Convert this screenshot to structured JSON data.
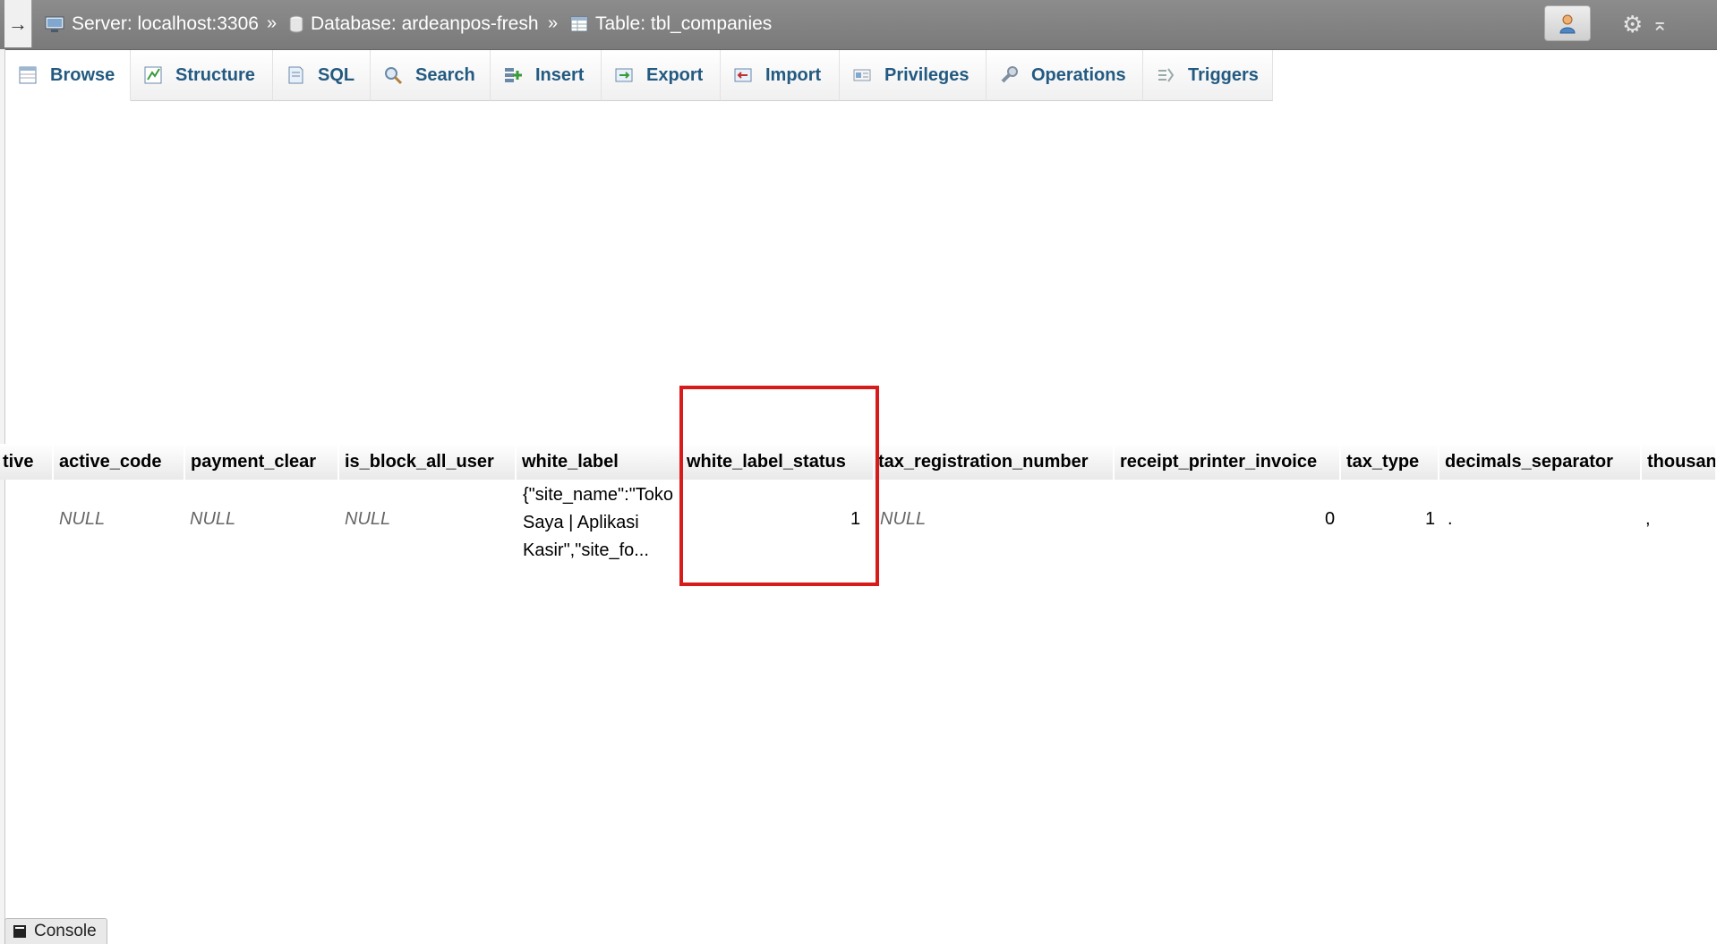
{
  "breadcrumb": {
    "toggle_icon": "→",
    "server": "Server: localhost:3306",
    "database": "Database: ardeanpos-fresh",
    "table": "Table: tbl_companies",
    "separator": "»"
  },
  "tabs": [
    {
      "label": "Browse",
      "icon": "browse-icon"
    },
    {
      "label": "Structure",
      "icon": "structure-icon"
    },
    {
      "label": "SQL",
      "icon": "sql-icon"
    },
    {
      "label": "Search",
      "icon": "search-icon"
    },
    {
      "label": "Insert",
      "icon": "insert-icon"
    },
    {
      "label": "Export",
      "icon": "export-icon"
    },
    {
      "label": "Import",
      "icon": "import-icon"
    },
    {
      "label": "Privileges",
      "icon": "privileges-icon"
    },
    {
      "label": "Operations",
      "icon": "operations-icon"
    },
    {
      "label": "Triggers",
      "icon": "triggers-icon"
    }
  ],
  "table": {
    "columns": [
      "tive",
      "active_code",
      "payment_clear",
      "is_block_all_user",
      "white_label",
      "white_label_status",
      "tax_registration_number",
      "receipt_printer_invoice",
      "tax_type",
      "decimals_separator",
      "thousan"
    ],
    "row": {
      "active_code": "NULL",
      "payment_clear": "NULL",
      "is_block_all_user": "NULL",
      "white_label_line1": "{\"site_name\":\"Toko",
      "white_label_line2": "Saya | Aplikasi",
      "white_label_line3": "Kasir\",\"site_fo...",
      "white_label_status": "1",
      "tax_registration_number": "NULL",
      "receipt_printer_invoice": "0",
      "tax_type": "1",
      "decimals_separator": ".",
      "thousands_separator": ","
    }
  },
  "console": {
    "label": "Console"
  },
  "colors": {
    "highlight": "#d71b1b",
    "tab_text": "#235a81",
    "topbar": "#7f7f7f"
  }
}
